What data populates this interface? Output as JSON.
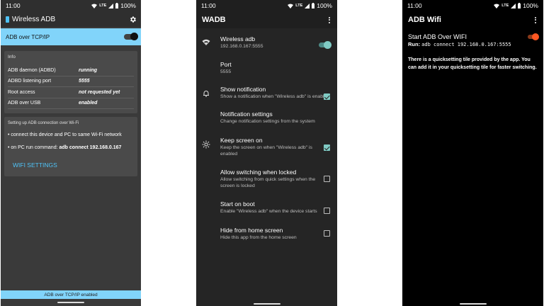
{
  "phone1": {
    "status": {
      "time": "11:00",
      "network": "LTE",
      "battery": "100%"
    },
    "app_title": "Wireless ADB",
    "toggle_label": "ADB over TCP/IP",
    "info": {
      "title": "Info",
      "rows": [
        {
          "key": "ADB daemon (ADBD)",
          "value": "running"
        },
        {
          "key": "ADBD listening port",
          "value": "5555"
        },
        {
          "key": "Root access",
          "value": "not requested yet"
        },
        {
          "key": "ADB over USB",
          "value": "enabled"
        }
      ]
    },
    "setup": {
      "title": "Setting up ADB connection over Wi-Fi",
      "line1": "• connect this device and PC to same Wi-Fi network",
      "line2_prefix": "• on PC run command: ",
      "line2_command": "adb connect 192.168.0.167",
      "button": "WIFI SETTINGS"
    },
    "bottom_status": "ADB over TCP/IP enabled"
  },
  "phone2": {
    "status": {
      "time": "11:00",
      "network": "LTE",
      "battery": "100%"
    },
    "app_title": "WADB",
    "prefs": [
      {
        "title": "Wireless adb",
        "summary": "192.168.0.167:5555",
        "icon": "wifi-icon",
        "control": "switch-on"
      },
      {
        "title": "Port",
        "summary": "5555",
        "icon": "",
        "control": "none"
      },
      {
        "title": "Show notification",
        "summary": "Show a notification when \"Wireless adb\" is enabled",
        "icon": "bell-icon",
        "control": "checkbox-checked"
      },
      {
        "title": "Notification settings",
        "summary": "Change notification settings from the system",
        "icon": "",
        "control": "none"
      },
      {
        "title": "Keep screen on",
        "summary": "Keep the screen on when \"Wireless adb\" is enabled",
        "icon": "brightness-icon",
        "control": "checkbox-checked"
      },
      {
        "title": "Allow switching when locked",
        "summary": "Allow switching from quick settings when the screen is locked",
        "icon": "",
        "control": "checkbox-unchecked"
      },
      {
        "title": "Start on boot",
        "summary": "Enable \"Wireless adb\" when the device starts",
        "icon": "",
        "control": "checkbox-unchecked"
      },
      {
        "title": "Hide from home screen",
        "summary": "Hide this app from the home screen",
        "icon": "",
        "control": "checkbox-unchecked"
      }
    ]
  },
  "phone3": {
    "status": {
      "time": "11:00",
      "network": "LTE",
      "battery": "100%"
    },
    "app_title": "ADB Wifi",
    "toggle_title": "Start ADB Over WIFI",
    "run_label": "Run: ",
    "run_command": "adb connect 192.168.0.167:5555",
    "description": "There is a quicksetting tile provided by the app. You can add it in your quicksetting tile for faster switching."
  },
  "colors": {
    "accent_blue": "#81d4fa",
    "link_blue": "#4fc3f7",
    "teal": "#80cbc4",
    "orange": "#ff5722"
  }
}
